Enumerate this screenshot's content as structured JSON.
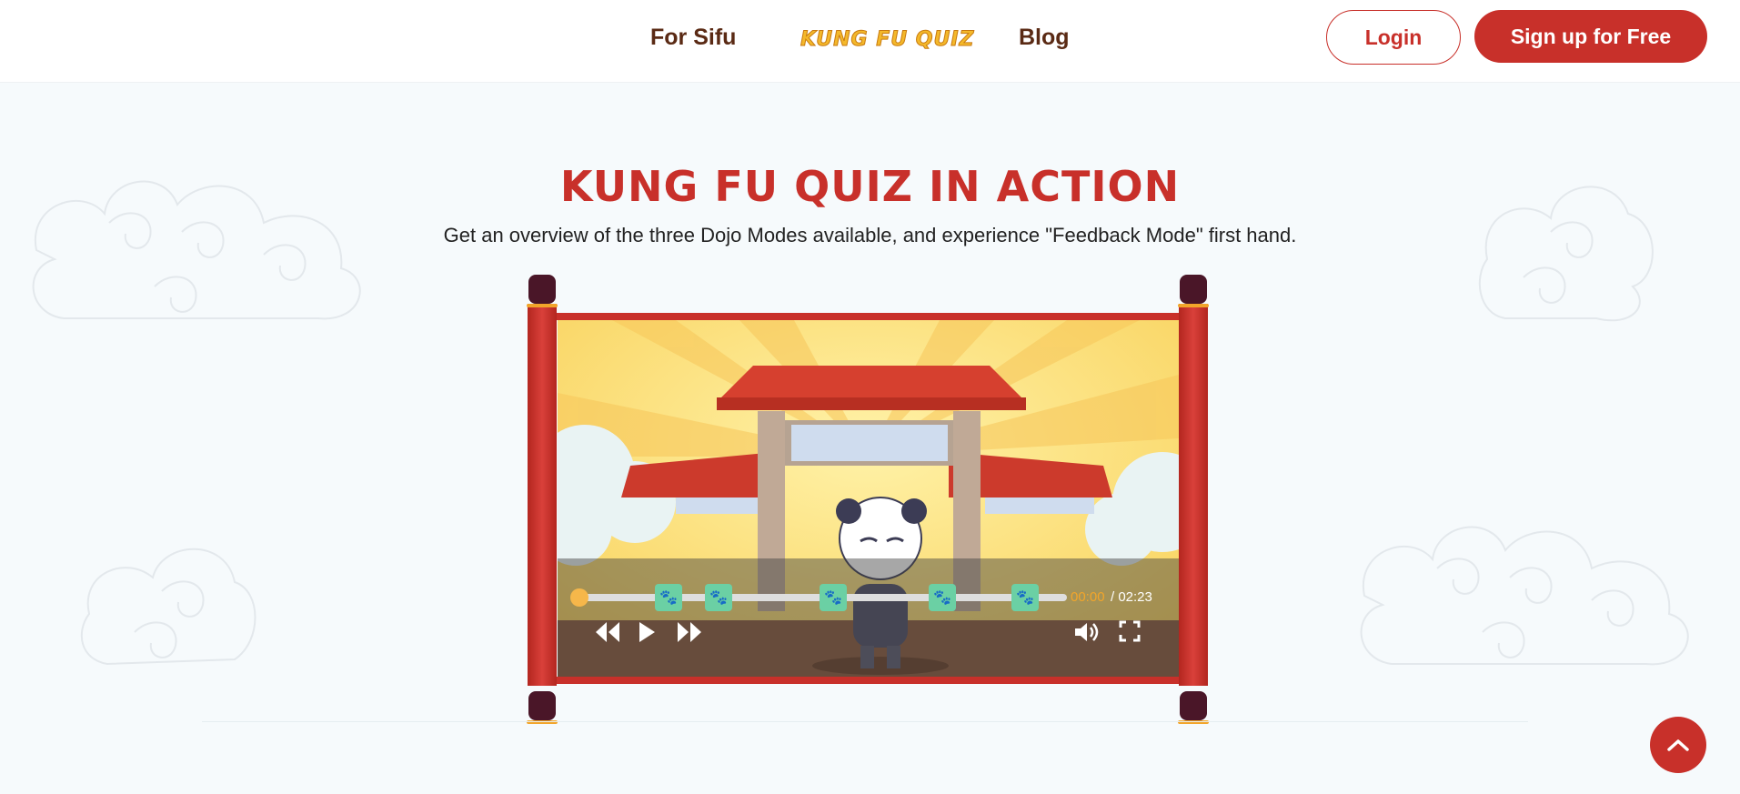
{
  "nav": {
    "for_sifu": "For Sifu",
    "logo": "KUNG FU QUIZ",
    "blog": "Blog",
    "login": "Login",
    "signup": "Sign up for Free"
  },
  "hero": {
    "title": "KUNG FU QUIZ IN ACTION",
    "subtitle": "Get an overview of the three Dojo Modes available, and experience \"Feedback Mode\" first hand."
  },
  "video": {
    "current_time": "00:00",
    "total_time": "/ 02:23",
    "progress": 0,
    "marker_icon": "paw-icon",
    "marker_count": 5
  },
  "colors": {
    "brand_red": "#c8302a",
    "nav_brown": "#5a2a14",
    "logo_yellow": "#f4b82a",
    "marker_green": "#6bd0a4",
    "time_orange": "#f2a52a"
  }
}
